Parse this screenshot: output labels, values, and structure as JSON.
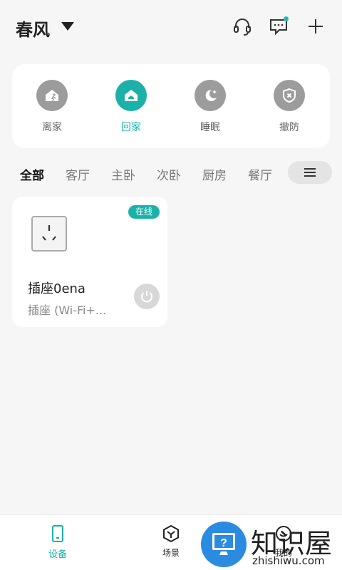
{
  "header": {
    "home_name": "春风"
  },
  "scenes": [
    {
      "label": "离家",
      "icon": "leave-home-icon",
      "active": false
    },
    {
      "label": "回家",
      "icon": "return-home-icon",
      "active": true
    },
    {
      "label": "睡眠",
      "icon": "sleep-moon-icon",
      "active": false
    },
    {
      "label": "撤防",
      "icon": "disarm-shield-icon",
      "active": false
    }
  ],
  "tabs": [
    "全部",
    "客厅",
    "主卧",
    "次卧",
    "厨房",
    "餐厅"
  ],
  "device": {
    "status": "在线",
    "name": "插座0ena",
    "type": "插座 (Wi-Fi+..."
  },
  "bottom_nav": {
    "devices": "设备",
    "scenes": "场景",
    "me": "我的"
  },
  "watermark": {
    "title": "知识屋",
    "url": "zhishiwu.com"
  },
  "colors": {
    "accent": "#1bb1a9",
    "background": "#f6f6f6",
    "inactive_icon": "#9c9c9c"
  }
}
